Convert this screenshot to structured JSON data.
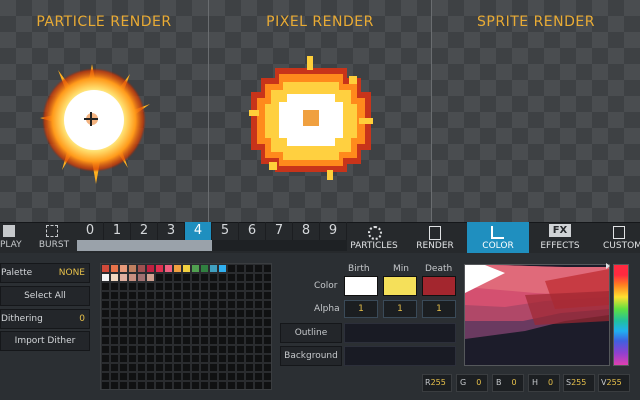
{
  "panels": [
    {
      "title": "PARTICLE RENDER"
    },
    {
      "title": "PIXEL RENDER"
    },
    {
      "title": "SPRITE RENDER"
    }
  ],
  "toolbar": {
    "play_label": "PLAY",
    "burst_label": "BURST",
    "frames": [
      "0",
      "1",
      "2",
      "3",
      "4",
      "5",
      "6",
      "7",
      "8",
      "9"
    ],
    "active_frame": "4"
  },
  "tabs": [
    {
      "label": "PARTICLES",
      "icon": "gear-icon"
    },
    {
      "label": "RENDER",
      "icon": "render-icon"
    },
    {
      "label": "COLOR",
      "icon": "color-curve-icon",
      "active": true
    },
    {
      "label": "EFFECTS",
      "icon": "fx-icon"
    },
    {
      "label": "CUSTOM",
      "icon": "custom-icon"
    }
  ],
  "fx_badge": "FX",
  "sidebar": {
    "palette_label": "Palette",
    "palette_value": "NONE",
    "select_all": "Select All",
    "dithering_label": "Dithering",
    "dithering_value": "0",
    "import_dither": "Import Dither"
  },
  "color": {
    "headers": {
      "birth": "Birth",
      "min": "Min",
      "death": "Death"
    },
    "color_label": "Color",
    "alpha_label": "Alpha",
    "birth_color": "#ffffff",
    "min_color": "#f5e05a",
    "death_color": "#a3262e",
    "alpha": {
      "birth": "1",
      "min": "1",
      "death": "1"
    },
    "outline_label": "Outline",
    "background_label": "Background"
  },
  "channels": [
    {
      "key": "R",
      "value": "255"
    },
    {
      "key": "G",
      "value": "0"
    },
    {
      "key": "B",
      "value": "0"
    },
    {
      "key": "H",
      "value": "0"
    },
    {
      "key": "S",
      "value": "255"
    },
    {
      "key": "V",
      "value": "255"
    }
  ],
  "swatch_colors": [
    "#d14a3a",
    "#e8734a",
    "#e89a7a",
    "#c08060",
    "#a05050",
    "#c02040",
    "#e03050",
    "#f06080",
    "#f0a040",
    "#f0d040",
    "#50a050",
    "#308040",
    "#40a0c0",
    "#30b0f0"
  ],
  "swatch_colors_row2": [
    "#f5f5f5",
    "#f0d8c0",
    "#e0b0a0",
    "#c89080",
    "#a07070",
    "#d0a090"
  ],
  "hue_strip": [
    "#ff3040",
    "#ff8020",
    "#ffe030",
    "#60e040",
    "#20c0a0",
    "#20b0f0",
    "#4060e0",
    "#9040d0",
    "#e040b0"
  ]
}
